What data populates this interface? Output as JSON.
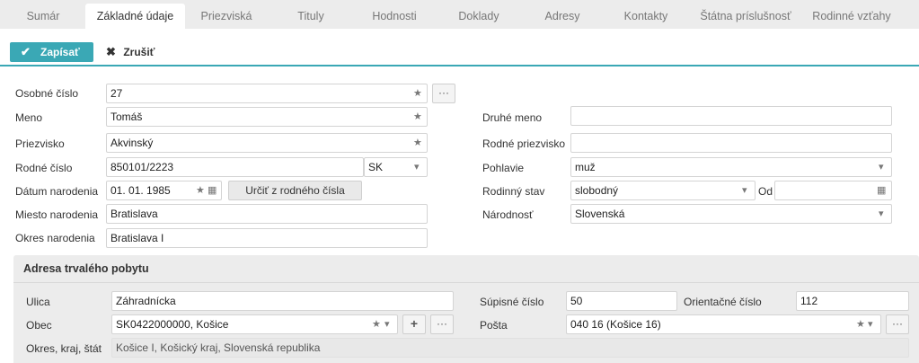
{
  "tabs": [
    "Sumár",
    "Základné údaje",
    "Priezviská",
    "Tituly",
    "Hodnosti",
    "Doklady",
    "Adresy",
    "Kontakty",
    "Štátna príslušnosť",
    "Rodinné vzťahy"
  ],
  "active_tab_index": 1,
  "toolbar": {
    "save_label": "Zapísať",
    "cancel_label": "Zrušiť"
  },
  "form": {
    "personal_number": {
      "label": "Osobné číslo",
      "value": "27"
    },
    "first_name": {
      "label": "Meno",
      "value": "Tomáš"
    },
    "surname": {
      "label": "Priezvisko",
      "value": "Akvinský"
    },
    "birth_number": {
      "label": "Rodné číslo",
      "value": "850101/2223",
      "country": "SK"
    },
    "birth_date": {
      "label": "Dátum narodenia",
      "value": "01. 01. 1985",
      "button": "Určiť z rodného čísla"
    },
    "birth_place": {
      "label": "Miesto narodenia",
      "value": "Bratislava"
    },
    "birth_district": {
      "label": "Okres narodenia",
      "value": "Bratislava I"
    },
    "middle_name": {
      "label": "Druhé meno",
      "value": ""
    },
    "maiden_name": {
      "label": "Rodné priezvisko",
      "value": ""
    },
    "gender": {
      "label": "Pohlavie",
      "value": "muž"
    },
    "marital_status": {
      "label": "Rodinný stav",
      "value": "slobodný",
      "since_label": "Od",
      "since_value": ""
    },
    "nationality": {
      "label": "Národnosť",
      "value": "Slovenská"
    }
  },
  "address": {
    "title": "Adresa trvalého pobytu",
    "street": {
      "label": "Ulica",
      "value": "Záhradnícka"
    },
    "registry_number": {
      "label": "Súpisné číslo",
      "value": "50"
    },
    "orientation_number": {
      "label": "Orientačné číslo",
      "value": "112"
    },
    "municipality": {
      "label": "Obec",
      "value": "SK0422000000, Košice"
    },
    "post": {
      "label": "Pošta",
      "value": "040 16 (Košice 16)"
    },
    "region": {
      "label": "Okres, kraj, štát",
      "value": "Košice I, Košický kraj, Slovenská republika"
    }
  },
  "colors": {
    "accent": "#3aa8b5",
    "tab_bar": "#ececec",
    "panel": "#ececec"
  }
}
